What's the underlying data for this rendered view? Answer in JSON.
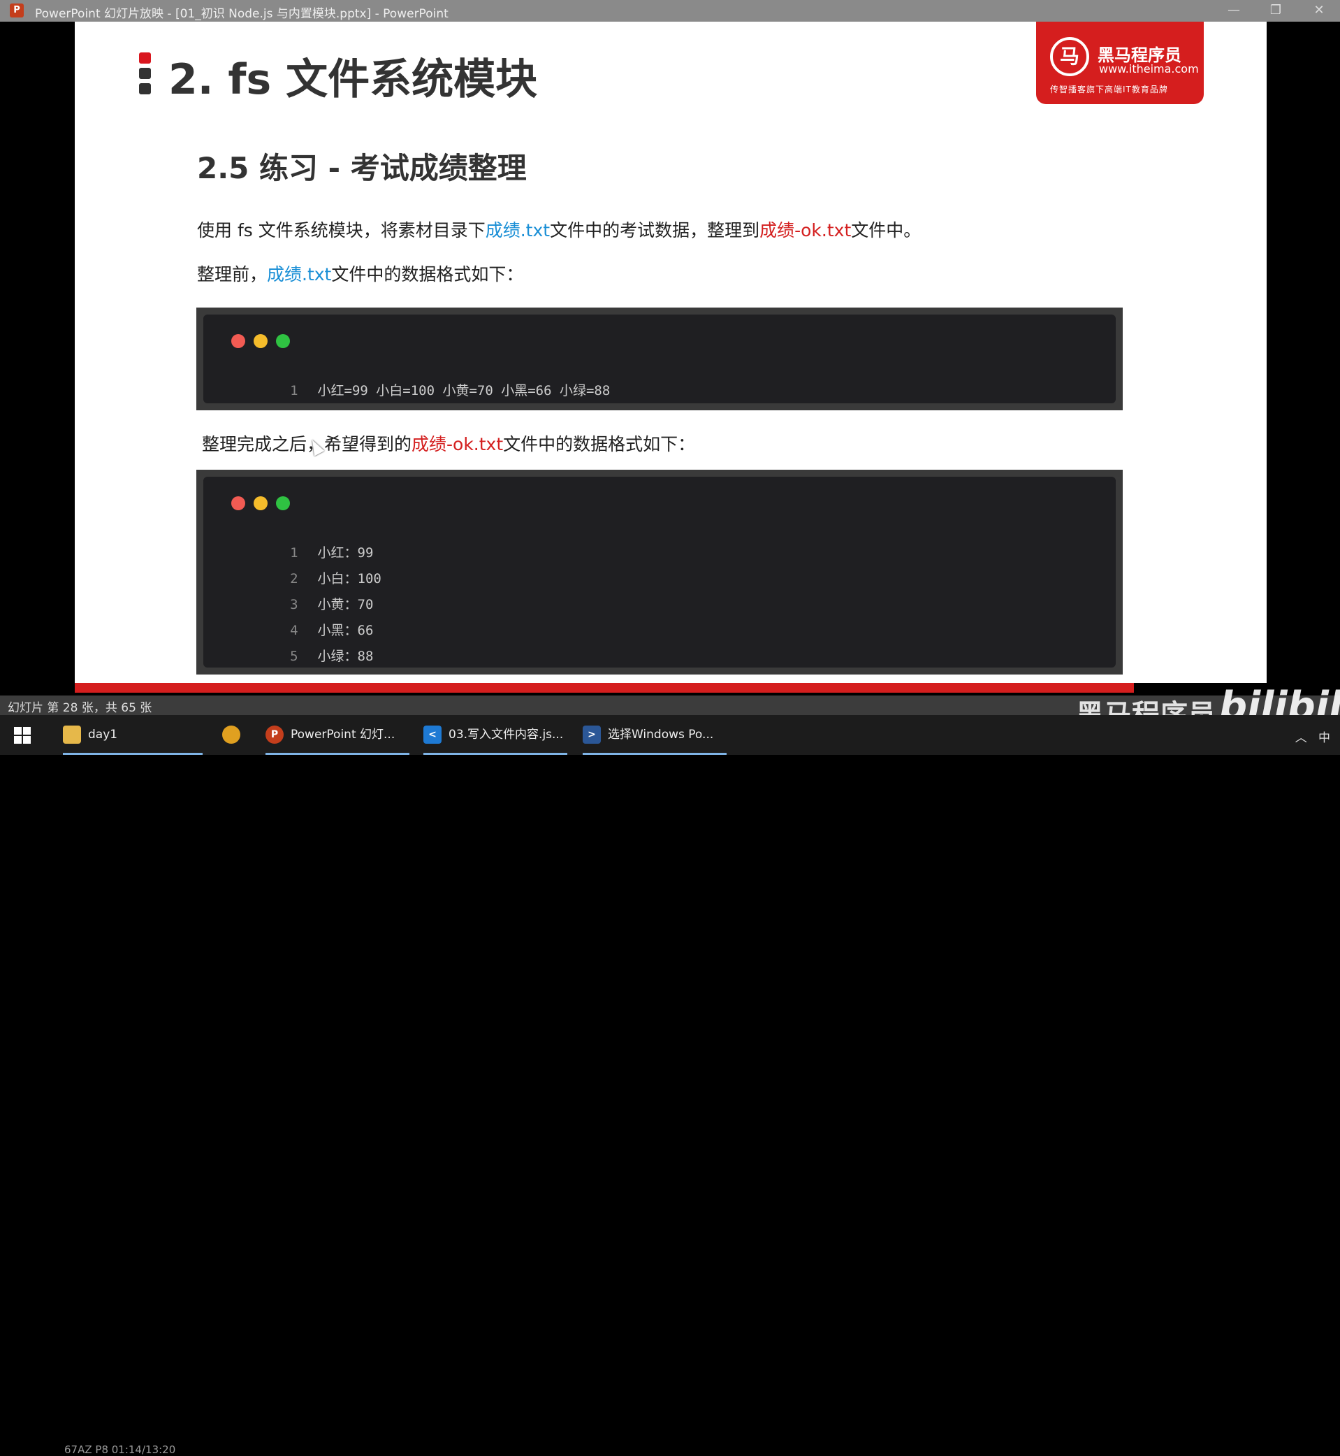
{
  "window": {
    "title": "PowerPoint 幻灯片放映 - [01_初识 Node.js 与内置模块.pptx] - PowerPoint",
    "app_icon": "P",
    "minimize": "—",
    "restore": "❐",
    "close": "✕"
  },
  "slide": {
    "title": "2. fs 文件系统模块",
    "subtitle": "2.5 练习 - 考试成绩整理",
    "para1": {
      "t1": "使用 fs 文件系统模块，将素材目录下",
      "link1": "成绩.txt",
      "t2": "文件中的考试数据，整理到",
      "link2": "成绩-ok.txt",
      "t3": "文件中。"
    },
    "para2": {
      "t1": "整理前，",
      "link1": "成绩.txt",
      "t2": "文件中的数据格式如下："
    },
    "para3": {
      "t1": "整理完成之后，希望得到的",
      "link1": "成绩-ok.txt",
      "t2": "文件中的数据格式如下："
    },
    "code_before": [
      {
        "num": "1",
        "text": "小红=99 小白=100 小黄=70 小黑=66 小绿=88"
      }
    ],
    "code_after": [
      {
        "num": "1",
        "text": "小红：99"
      },
      {
        "num": "2",
        "text": "小白：100"
      },
      {
        "num": "3",
        "text": "小黄：70"
      },
      {
        "num": "4",
        "text": "小黑：66"
      },
      {
        "num": "5",
        "text": "小绿：88"
      }
    ],
    "logo": {
      "emblem": "马",
      "name": "黑马程序员",
      "url": "www.itheima.com",
      "slogan": "传智播客旗下高端IT教育品牌"
    }
  },
  "statusbar": {
    "slide_count": "幻灯片 第 28 张，共 65 张"
  },
  "watermark": {
    "brand": "黑马程序员",
    "site": "bilibili"
  },
  "taskbar": {
    "items": [
      {
        "label": "day1",
        "icon": "folder-icon"
      },
      {
        "label": "PowerPoint 幻灯...",
        "icon": "powerpoint-icon"
      },
      {
        "label": "03.写入文件内容.js...",
        "icon": "vscode-icon"
      },
      {
        "label": "选择Windows Po...",
        "icon": "powershell-icon"
      }
    ],
    "overlay": "67AZ P8 01:14/13:20",
    "ime": "中"
  },
  "colors": {
    "brand_red": "#d51e1e",
    "link_blue": "#1a8fd6",
    "link_red": "#d42020"
  }
}
